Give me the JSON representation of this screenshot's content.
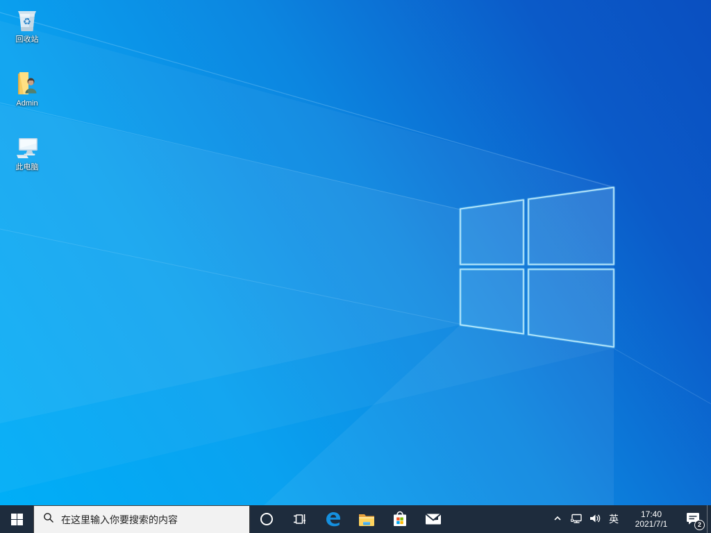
{
  "desktop": {
    "icons": [
      {
        "name": "recycle-bin",
        "label": "回收站"
      },
      {
        "name": "admin-user-folder",
        "label": "Admin"
      },
      {
        "name": "this-pc",
        "label": "此电脑"
      }
    ]
  },
  "taskbar": {
    "search_placeholder": "在这里输入你要搜索的内容",
    "app_icons": [
      "start",
      "cortana",
      "task-view",
      "edge",
      "file-explorer",
      "microsoft-store",
      "mail"
    ],
    "tray": {
      "icons": [
        "hidden-icons-chevron",
        "network",
        "volume",
        "action-center",
        "show-desktop"
      ],
      "language": "英",
      "time": "17:40",
      "date": "2021/7/1",
      "notification_count": "2"
    }
  },
  "colors": {
    "taskbar_bg": "#1e2c3d",
    "wallpaper_bright": "#00aef7",
    "wallpaper_deep": "#0a4fc0",
    "logo_edge_glow": "#9feaff",
    "search_box_bg": "#f2f2f2",
    "edge_blue": "#1386dd",
    "folder_yellow": "#ffd45e",
    "ms_logo_red": "#f25022",
    "ms_logo_green": "#7fba00",
    "ms_logo_blue": "#00a4ef",
    "ms_logo_yellow": "#ffb900"
  }
}
